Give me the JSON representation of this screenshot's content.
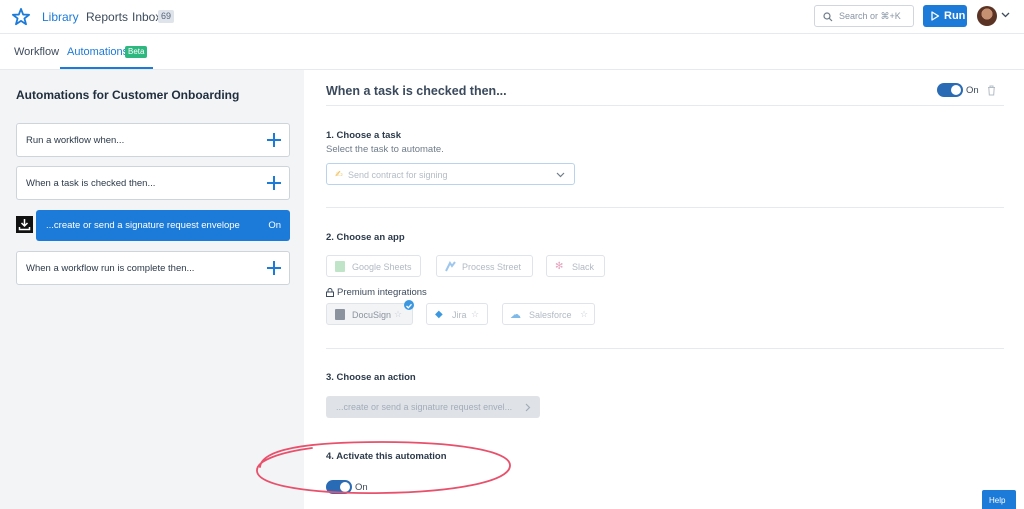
{
  "nav": {
    "library": "Library",
    "reports": "Reports",
    "inbox": "Inbox",
    "inbox_count": "69",
    "search_placeholder": "Search or ⌘+K",
    "run": "Run"
  },
  "tabs": {
    "workflow": "Workflow",
    "automations": "Automations",
    "beta": "Beta"
  },
  "left": {
    "title": "Automations for Customer Onboarding",
    "cards": [
      "Run a workflow when...",
      "When a task is checked then...",
      "...create or send a signature request envelope",
      "When a workflow run is complete then..."
    ],
    "active_on": "On"
  },
  "right": {
    "title": "When a task is checked then...",
    "toggle_label": "On",
    "step1": {
      "heading": "1. Choose a task",
      "sub": "Select the task to automate.",
      "value": "Send contract for signing"
    },
    "step2": {
      "heading": "2. Choose an app",
      "apps": [
        "Google Sheets",
        "Process Street",
        "Slack"
      ],
      "premium_label": "Premium integrations",
      "premium_apps": [
        "DocuSign",
        "Jira",
        "Salesforce"
      ]
    },
    "step3": {
      "heading": "3. Choose an action",
      "value": "...create or send a signature request envel..."
    },
    "step4": {
      "heading": "4. Activate this automation",
      "toggle_label": "On"
    }
  },
  "help": "Help",
  "colors": {
    "accent": "#1c7bd8",
    "toggle": "#2a6bb5",
    "beta": "#2eb87f",
    "annotation": "#e8506b"
  }
}
